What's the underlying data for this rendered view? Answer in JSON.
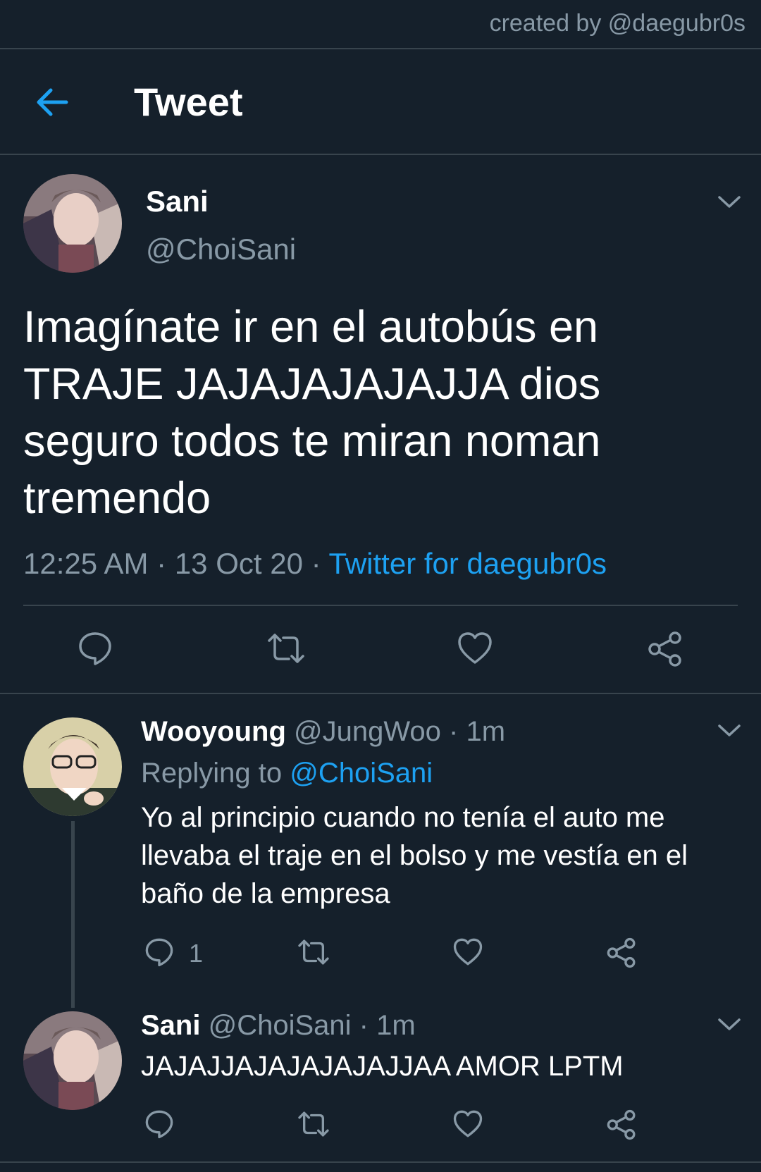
{
  "watermark": "created by @daegubr0s",
  "header": {
    "title": "Tweet",
    "back_icon": "back-arrow-icon"
  },
  "main_tweet": {
    "name": "Sani",
    "handle": "@ChoiSani",
    "text": "Imagínate ir en el autobús en TRAJE JAJAJAJAJAJJA dios seguro todos te miran noman tremendo",
    "time": "12:25 AM",
    "date": "13 Oct 20",
    "source": "Twitter for daegubr0s",
    "separator": "·"
  },
  "replies": [
    {
      "name": "Wooyoung",
      "handle": "@JungWoo",
      "time": "1m",
      "replying_label": "Replying to",
      "replying_to": "@ChoiSani",
      "text": "Yo al principio cuando no tenía el auto me llevaba el traje en el bolso y me vestía en el baño de la empresa",
      "reply_count": "1"
    },
    {
      "name": "Sani",
      "handle": "@ChoiSani",
      "time": "1m",
      "text": "JAJAJJAJAJAJAJAJJAA AMOR LPTM"
    }
  ],
  "colors": {
    "background": "#15202b",
    "divider": "#38444d",
    "secondary_text": "#8899a6",
    "accent": "#1da1f2"
  }
}
